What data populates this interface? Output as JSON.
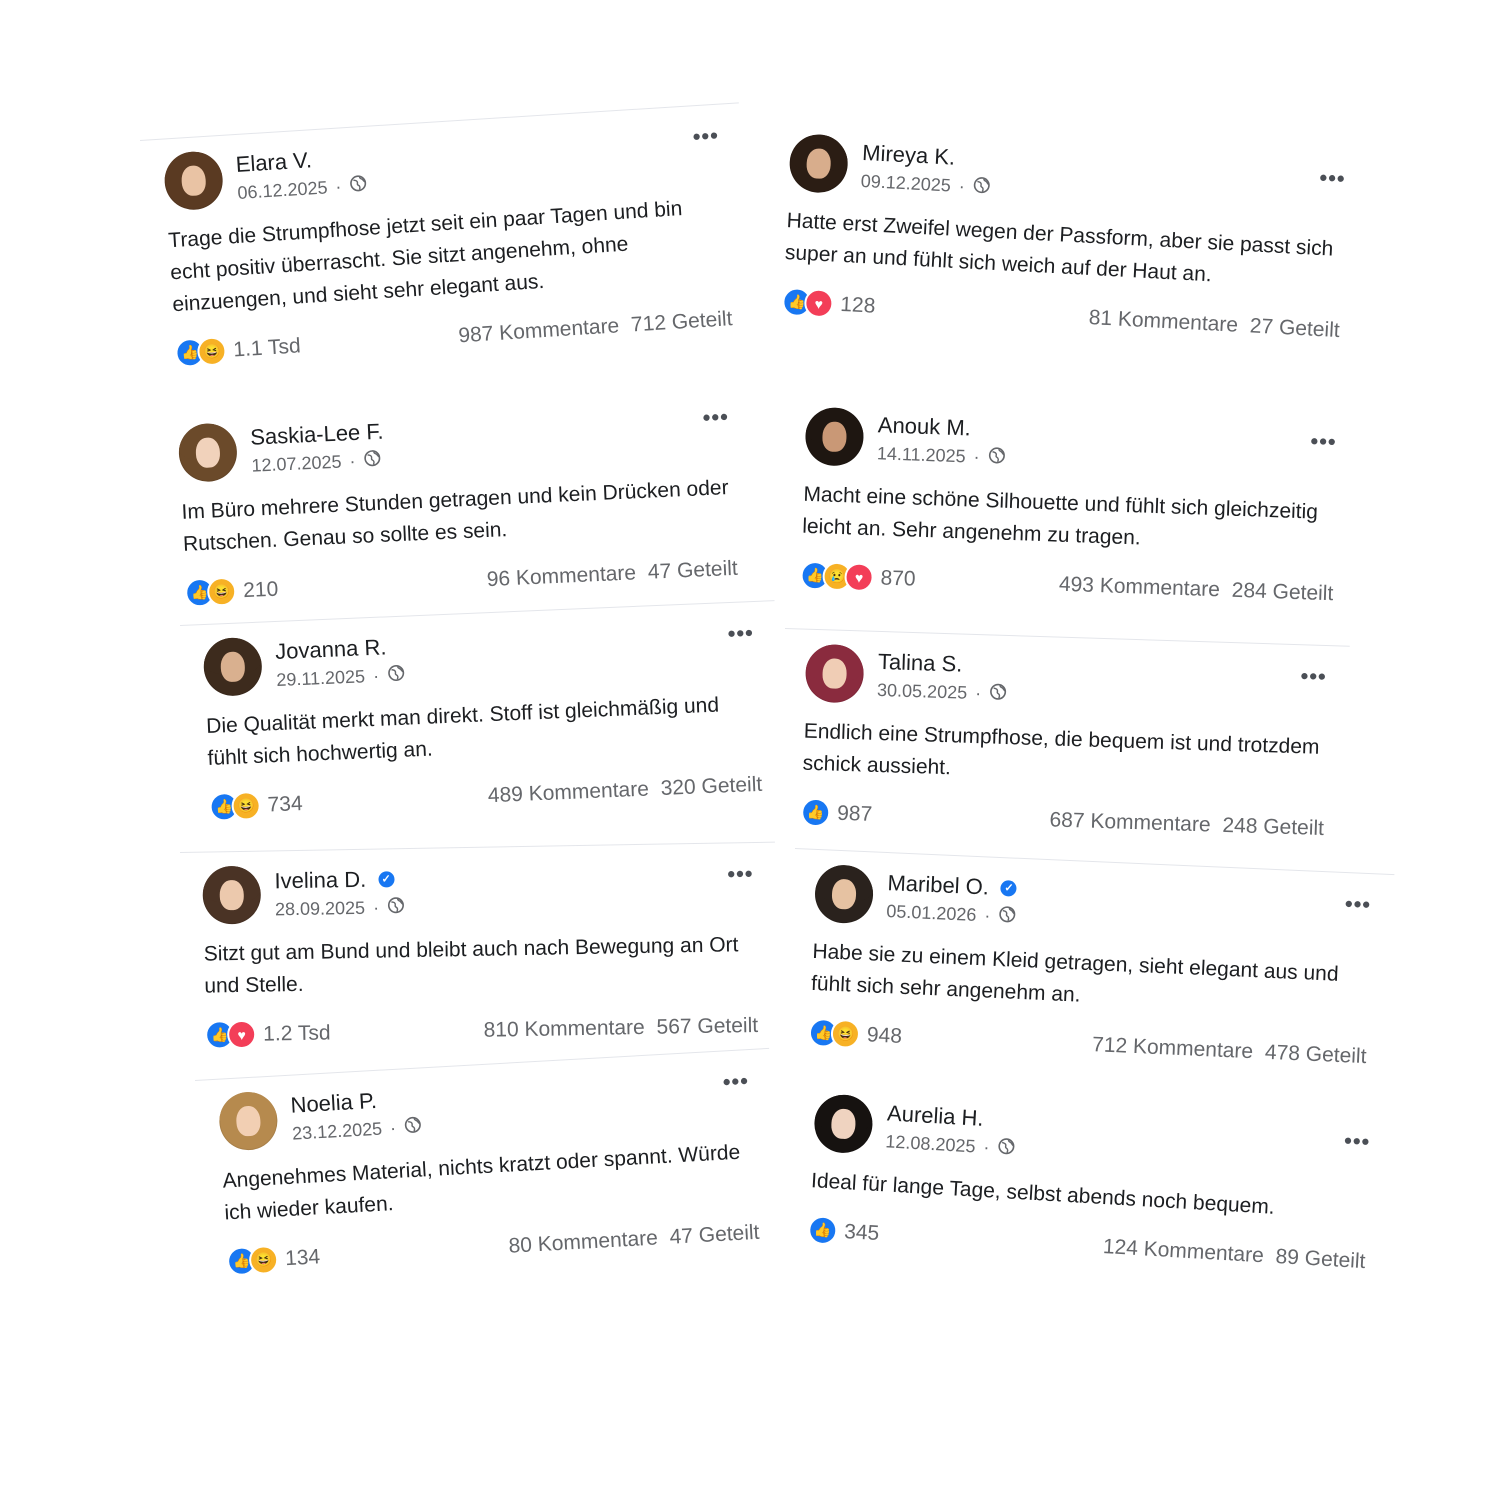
{
  "posts": [
    {
      "name": "Elara V.",
      "verified": false,
      "date": "06.12.2025",
      "text": "Trage die Strumpfhose jetzt seit ein paar Tagen und bin echt positiv überrascht. Sie sitzt angenehm, ohne einzuengen, und sieht sehr elegant aus.",
      "reactions": [
        "like",
        "haha"
      ],
      "reaction_count": "1.1 Tsd",
      "comments": "987 Kommentare",
      "shares": "712 Geteilt"
    },
    {
      "name": "Saskia-Lee F.",
      "verified": false,
      "date": "12.07.2025",
      "text": "Im Büro mehrere Stunden getragen und kein Drücken oder Rutschen. Genau so sollte es sein.",
      "reactions": [
        "like",
        "haha"
      ],
      "reaction_count": "210",
      "comments": "96 Kommentare",
      "shares": "47 Geteilt"
    },
    {
      "name": "Jovanna R.",
      "verified": false,
      "date": "29.11.2025",
      "text": "Die Qualität merkt man direkt. Stoff ist gleichmäßig und fühlt sich hochwertig an.",
      "reactions": [
        "like",
        "haha"
      ],
      "reaction_count": "734",
      "comments": "489 Kommentare",
      "shares": "320 Geteilt"
    },
    {
      "name": "Ivelina D.",
      "verified": true,
      "date": "28.09.2025",
      "text": "Sitzt gut am Bund und bleibt auch nach Bewegung an Ort und Stelle.",
      "reactions": [
        "like",
        "love"
      ],
      "reaction_count": "1.2 Tsd",
      "comments": "810 Kommentare",
      "shares": "567 Geteilt"
    },
    {
      "name": "Noelia P.",
      "verified": false,
      "date": "23.12.2025",
      "text": "Angenehmes Material, nichts kratzt oder spannt. Würde ich wieder kaufen.",
      "reactions": [
        "like",
        "haha"
      ],
      "reaction_count": "134",
      "comments": "80 Kommentare",
      "shares": "47 Geteilt"
    },
    {
      "name": "Mireya K.",
      "verified": false,
      "date": "09.12.2025",
      "text": "Hatte erst Zweifel wegen der Passform, aber sie passt sich super an und fühlt sich weich auf der Haut an.",
      "reactions": [
        "like",
        "love"
      ],
      "reaction_count": "128",
      "comments": "81 Kommentare",
      "shares": "27 Geteilt"
    },
    {
      "name": "Anouk M.",
      "verified": false,
      "date": "14.11.2025",
      "text": "Macht eine schöne Silhouette und fühlt sich gleichzeitig leicht an. Sehr angenehm zu tragen.",
      "reactions": [
        "like",
        "sad",
        "love"
      ],
      "reaction_count": "870",
      "comments": "493 Kommentare",
      "shares": "284 Geteilt"
    },
    {
      "name": "Talina S.",
      "verified": false,
      "date": "30.05.2025",
      "text": "Endlich eine Strumpfhose, die bequem ist und trotzdem schick aussieht.",
      "reactions": [
        "like"
      ],
      "reaction_count": "987",
      "comments": "687 Kommentare",
      "shares": "248 Geteilt"
    },
    {
      "name": "Maribel O.",
      "verified": true,
      "date": "05.01.2026",
      "text": "Habe sie zu einem Kleid getragen, sieht elegant aus und fühlt sich sehr angenehm an.",
      "reactions": [
        "like",
        "haha"
      ],
      "reaction_count": "948",
      "comments": "712 Kommentare",
      "shares": "478 Geteilt"
    },
    {
      "name": "Aurelia H.",
      "verified": false,
      "date": "12.08.2025",
      "text": "Ideal für lange Tage, selbst abends noch bequem.",
      "reactions": [
        "like"
      ],
      "reaction_count": "345",
      "comments": "124 Kommentare",
      "shares": "89 Geteilt"
    }
  ],
  "separator": "·",
  "more_glyph": "•••",
  "verified_glyph": "✓",
  "reaction_glyphs": {
    "like": "👍",
    "haha": "😆",
    "love": "♥",
    "sad": "😢"
  },
  "colors": {
    "like": "#1877f2",
    "love": "#f33e58",
    "haha": "#f7b125",
    "verified": "#1877f2",
    "meta": "#65676b"
  }
}
